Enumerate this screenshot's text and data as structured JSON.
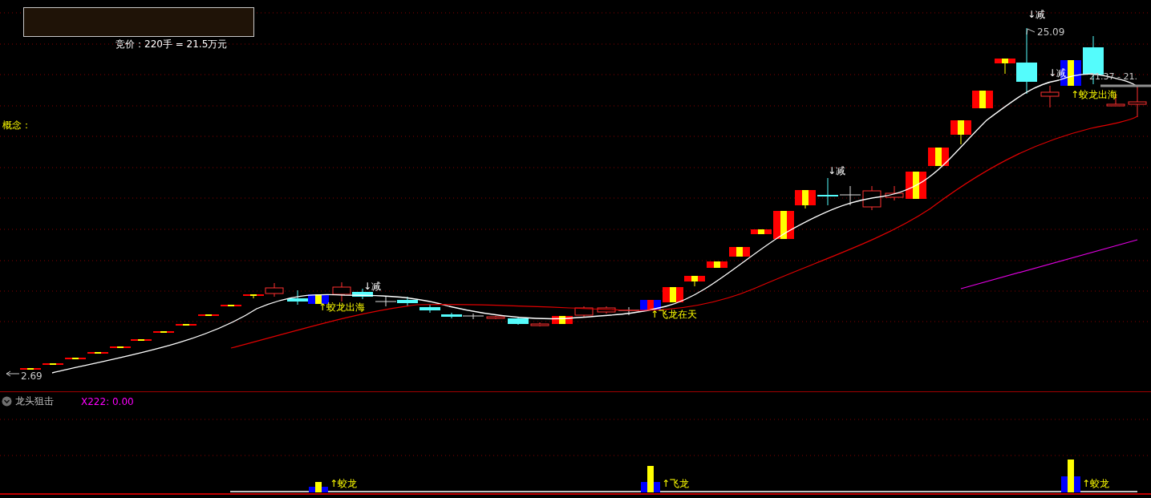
{
  "quote_panel": {
    "auction": "竞价：220手 = 21.5万元"
  },
  "concept": {
    "label": "概念："
  },
  "price_labels": [
    {
      "kind": "high",
      "text": "25.09"
    },
    {
      "kind": "low",
      "text": "2.69"
    },
    {
      "kind": "range",
      "text": "21.37 - 21."
    }
  ],
  "signals": [
    {
      "kind": "sell",
      "text": "↓减"
    },
    {
      "kind": "sell",
      "text": "↓减"
    },
    {
      "kind": "sell",
      "text": "↓减"
    },
    {
      "kind": "sell",
      "text": "↓减"
    },
    {
      "kind": "buy",
      "text": "↑蛟龙出海"
    },
    {
      "kind": "buy",
      "text": "↑蛟龙出海"
    },
    {
      "kind": "buy",
      "text": "↑飞龙在天"
    }
  ],
  "indicator": {
    "name": "龙头狙击",
    "value": "X222: 0.00",
    "labels": [
      {
        "text": "↑蛟龙"
      },
      {
        "text": "↑飞龙"
      },
      {
        "text": "↑蛟龙"
      }
    ]
  }
}
